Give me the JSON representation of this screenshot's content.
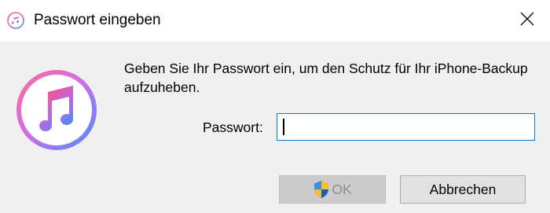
{
  "window": {
    "title": "Passwort eingeben",
    "close_icon": "close-icon",
    "title_icon": "itunes-music-icon"
  },
  "dialog": {
    "message": "Geben Sie Ihr Passwort ein, um den Schutz für Ihr iPhone-Backup aufzuheben.",
    "app_icon": "itunes-music-icon",
    "password_label": "Passwort:",
    "password_value": "",
    "password_placeholder": ""
  },
  "buttons": {
    "ok_label": "OK",
    "ok_icon": "uac-shield-icon",
    "ok_enabled": false,
    "cancel_label": "Abbrechen"
  },
  "colors": {
    "titlebar_bg": "#ffffff",
    "body_bg": "#f0f0f0",
    "input_focus_border": "#0078d7",
    "disabled_button_bg": "#cccccc",
    "button_bg": "#e1e1e1"
  }
}
